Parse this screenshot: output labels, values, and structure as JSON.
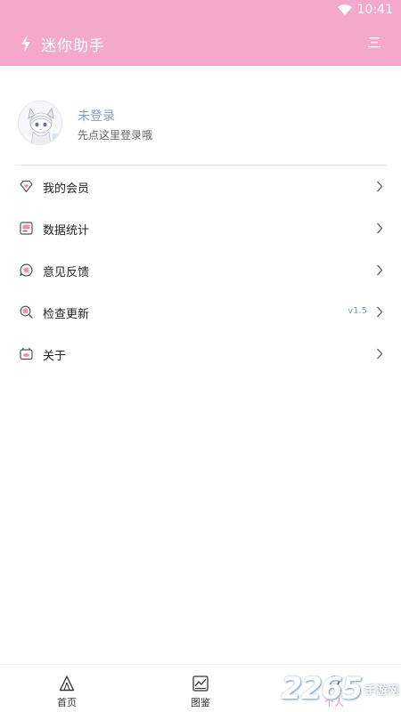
{
  "status_bar": {
    "time": "10:41",
    "wifi_icon": "wifi-icon"
  },
  "app_bar": {
    "title": "迷你助手",
    "left_icon": "bolt-icon",
    "right_icon": "menu-icon"
  },
  "profile": {
    "title": "未登录",
    "subtitle": "先点这里登录哦",
    "avatar_icon": "avatar-illustration"
  },
  "menu": {
    "items": [
      {
        "label": "我的会员",
        "icon": "diamond-icon",
        "extra": ""
      },
      {
        "label": "数据统计",
        "icon": "chart-box-icon",
        "extra": ""
      },
      {
        "label": "意见反馈",
        "icon": "feedback-icon",
        "extra": ""
      },
      {
        "label": "检查更新",
        "icon": "search-update-icon",
        "extra": "v1.5"
      },
      {
        "label": "关于",
        "icon": "about-icon",
        "extra": ""
      }
    ]
  },
  "tab_bar": {
    "tabs": [
      {
        "label": "首页",
        "icon": "tent-icon",
        "active": false
      },
      {
        "label": "图鉴",
        "icon": "image-chart-icon",
        "active": false
      },
      {
        "label": "个人",
        "icon": "person-icon",
        "active": true
      }
    ]
  },
  "watermark": {
    "number": "2265",
    "text": "手游网"
  },
  "colors": {
    "primary": "#f4a8cb",
    "accent": "#f08cb8",
    "muted": "#8aa0b8"
  }
}
